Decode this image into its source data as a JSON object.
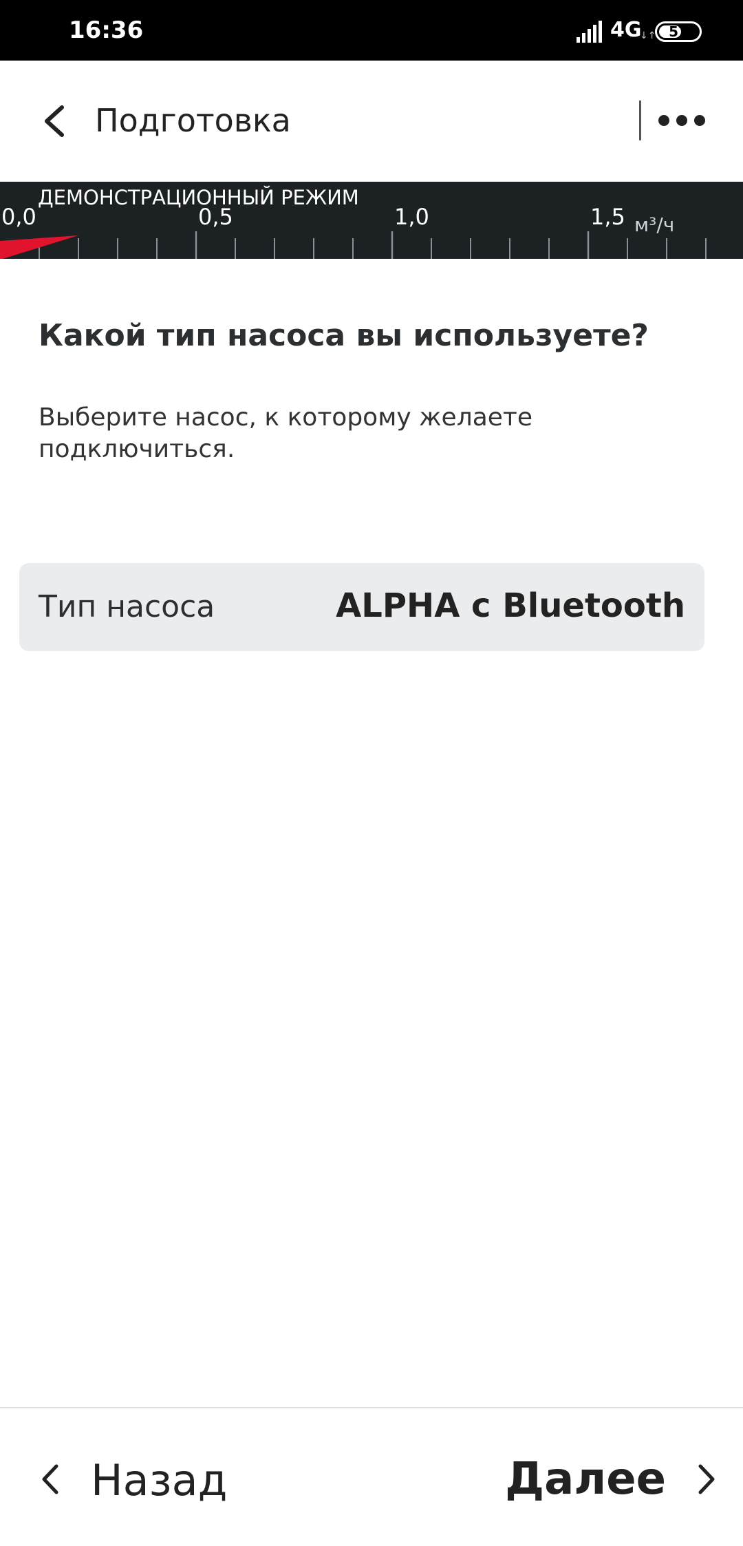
{
  "status_bar": {
    "time": "16:36",
    "network": "4G",
    "battery": "57",
    "battery_level": 57,
    "icons": [
      "signal-icon",
      "battery-icon"
    ]
  },
  "header": {
    "title": "Подготовка",
    "icons": [
      "back-icon",
      "more-icon"
    ]
  },
  "gauge": {
    "demo_label": "ДЕМОНСТРАЦИОННЫЙ РЕЖИМ",
    "ticks": [
      "0,0",
      "0,5",
      "1,0",
      "1,5"
    ],
    "unit": "м³/ч",
    "flow_value": 0.2,
    "accent_color": "#e2142d"
  },
  "content": {
    "question": "Какой тип насоса вы используете?",
    "subtitle": "Выберите насос, к которому желаете подключиться.",
    "pump_type_label": "Тип насоса",
    "pump_type_value": "ALPHA с Bluetooth"
  },
  "bottom_nav": {
    "back_label": "Назад",
    "next_label": "Далее",
    "icons": [
      "chevron-left-icon",
      "chevron-right-icon"
    ]
  }
}
